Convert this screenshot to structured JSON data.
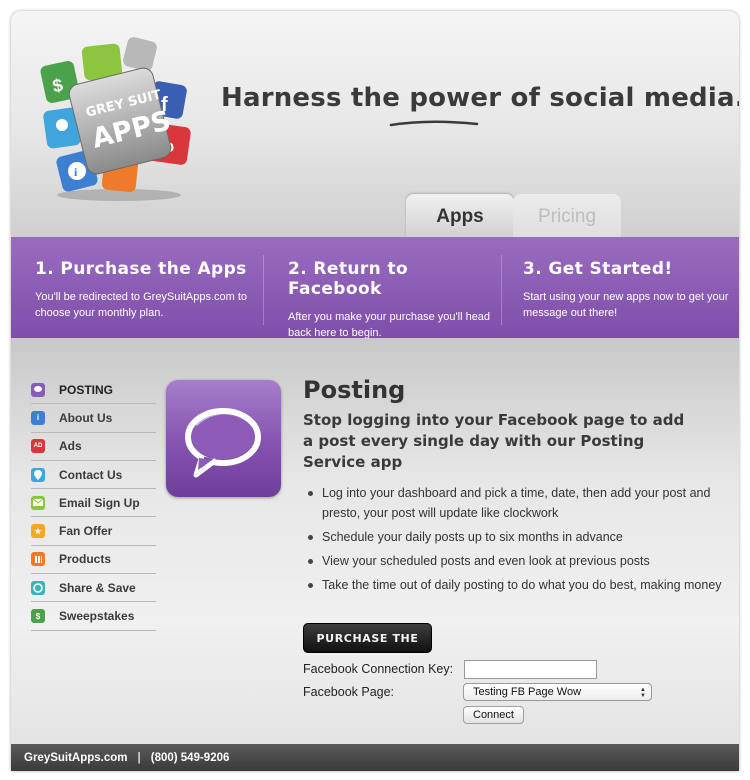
{
  "header": {
    "logo_text_1": "GREY SUIT",
    "logo_text_2": "APPS",
    "tagline_pre": "Harness the ",
    "tagline_hl": "power",
    "tagline_post": " of social media."
  },
  "tabs": [
    {
      "label": "Apps",
      "active": true
    },
    {
      "label": "Pricing",
      "active": false
    }
  ],
  "steps": [
    {
      "title": "1. Purchase the Apps",
      "text": "You'll be redirected to GreySuitApps.com to choose your monthly plan."
    },
    {
      "title": "2. Return to Facebook",
      "text": "After you make your purchase you'll head back here to begin."
    },
    {
      "title": "3. Get Started!",
      "text": "Start using your new apps now to get your message out there!"
    }
  ],
  "sidebar": {
    "items": [
      {
        "label": "POSTING",
        "icon": "speech-bubble-icon",
        "color": "#8a5db5"
      },
      {
        "label": "About Us",
        "icon": "info-icon",
        "color": "#3d7fd1"
      },
      {
        "label": "Ads",
        "icon": "ad-icon",
        "color": "#d9373b"
      },
      {
        "label": "Contact Us",
        "icon": "map-pin-icon",
        "color": "#3fa5dc"
      },
      {
        "label": "Email Sign Up",
        "icon": "email-icon",
        "color": "#8cc63f"
      },
      {
        "label": "Fan Offer",
        "icon": "star-icon",
        "color": "#f5a623"
      },
      {
        "label": "Products",
        "icon": "products-icon",
        "color": "#f07a2b"
      },
      {
        "label": "Share & Save",
        "icon": "share-icon",
        "color": "#3db2b7"
      },
      {
        "label": "Sweepstakes",
        "icon": "money-bag-icon",
        "color": "#4aa34a"
      }
    ]
  },
  "main": {
    "title": "Posting",
    "subtitle": "Stop logging into your Facebook page to add a post every single day with our Posting Service app",
    "bullets": [
      "Log into your dashboard and pick a time, date, then add your post and presto, your post will update like clockwork",
      "Schedule your daily posts up to six months in advance",
      "View your scheduled posts and even look at previous posts",
      "Take the time out of daily posting to do what you do best, making money"
    ],
    "buy_label": "PURCHASE THE APPS"
  },
  "form": {
    "key_label": "Facebook Connection Key:",
    "key_value": "",
    "page_label": "Facebook Page:",
    "page_selected": "Testing FB Page Wow",
    "connect_label": "Connect"
  },
  "footer": {
    "site": "GreySuitApps.com",
    "separator": "|",
    "phone": "(800) 549-9206"
  },
  "colors": {
    "purple_band": "#8a5db5",
    "footer": "#444444"
  }
}
